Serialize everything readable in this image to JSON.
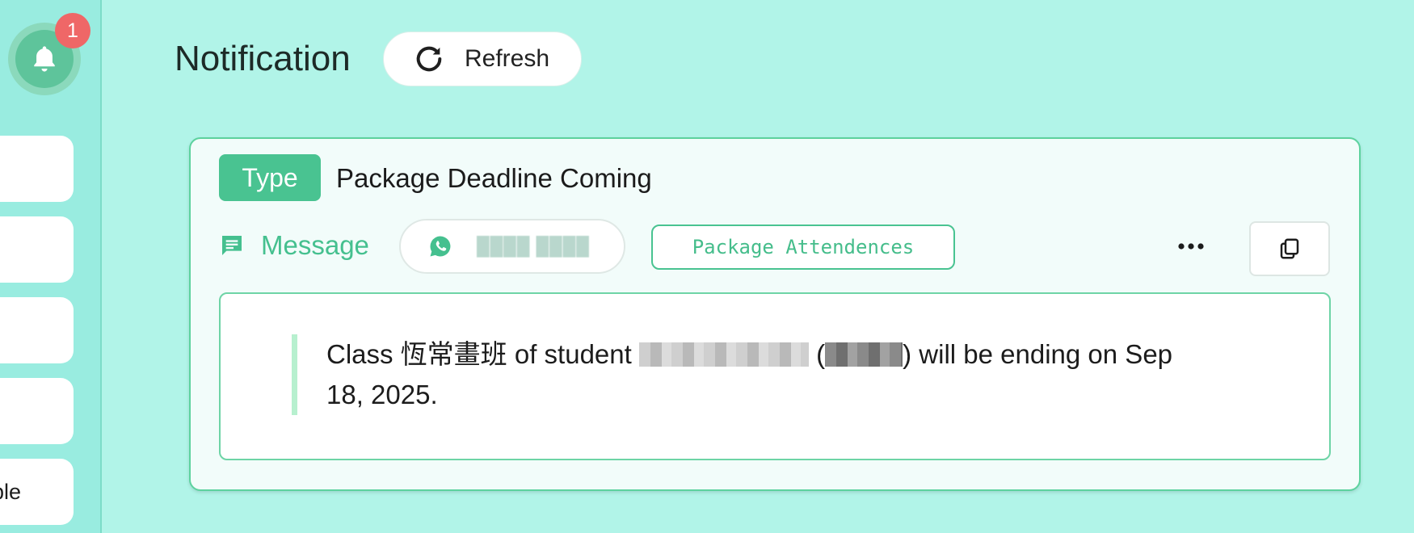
{
  "sidebar": {
    "notification_badge": "1",
    "items": [
      {
        "label": ""
      },
      {
        "label": ""
      },
      {
        "label": ""
      },
      {
        "label": ""
      },
      {
        "label": "ple"
      }
    ]
  },
  "header": {
    "title": "Notification",
    "refresh_label": "Refresh"
  },
  "notification": {
    "type_tag": "Type",
    "type_value": "Package Deadline Coming",
    "message_label": "Message",
    "package_button": "Package Attendences",
    "more_label": "•••",
    "text_prefix": "Class 恆常畫班 of student",
    "text_open": "(",
    "text_suffix": ") will be ending on Sep 18, 2025."
  }
}
